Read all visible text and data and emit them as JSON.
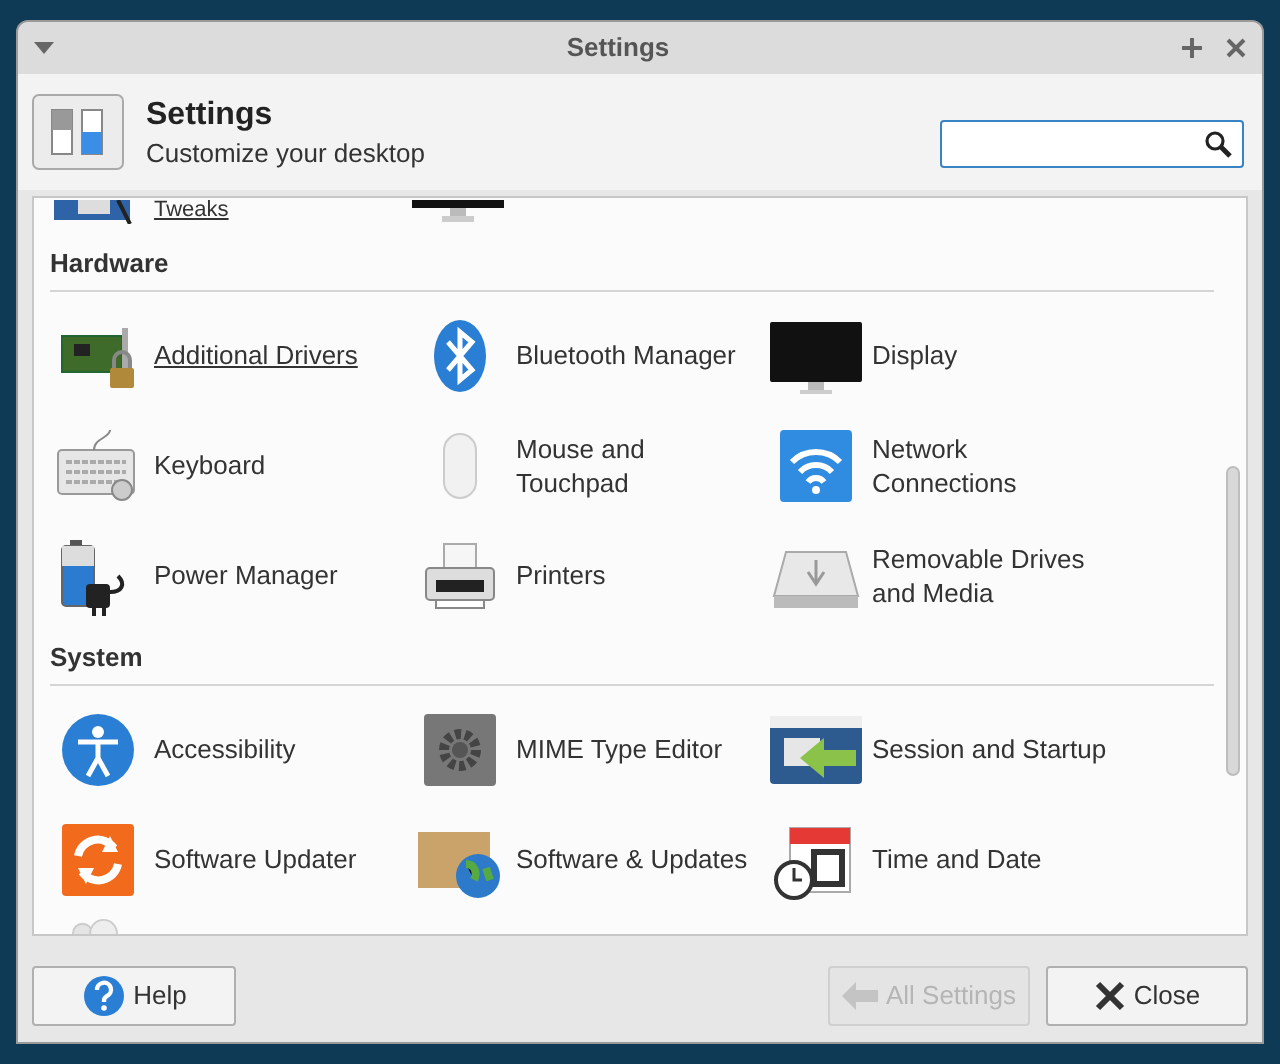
{
  "window": {
    "title": "Settings"
  },
  "header": {
    "title": "Settings",
    "subtitle": "Customize your desktop"
  },
  "partial_row": {
    "label": "Tweaks",
    "hovered": true
  },
  "sections": [
    {
      "title": "Hardware",
      "items": [
        {
          "label": "Additional Drivers",
          "hovered": true
        },
        {
          "label": "Bluetooth Manager",
          "hovered": false
        },
        {
          "label": "Display",
          "hovered": false
        },
        {
          "label": "Keyboard",
          "hovered": false
        },
        {
          "label": "Mouse and Touchpad",
          "hovered": false
        },
        {
          "label": "Network Connections",
          "hovered": false
        },
        {
          "label": "Power Manager",
          "hovered": false
        },
        {
          "label": "Printers",
          "hovered": false
        },
        {
          "label": "Removable Drives and Media",
          "hovered": false
        }
      ]
    },
    {
      "title": "System",
      "items": [
        {
          "label": "Accessibility",
          "hovered": false
        },
        {
          "label": "MIME Type Editor",
          "hovered": false
        },
        {
          "label": "Session and Startup",
          "hovered": false
        },
        {
          "label": "Software Updater",
          "hovered": false
        },
        {
          "label": "Software & Updates",
          "hovered": false
        },
        {
          "label": "Time and Date",
          "hovered": false
        }
      ]
    }
  ],
  "buttons": [
    {
      "label": "Help",
      "disabled": false
    },
    {
      "label": "All Settings",
      "disabled": true
    },
    {
      "label": "Close",
      "disabled": false
    }
  ]
}
